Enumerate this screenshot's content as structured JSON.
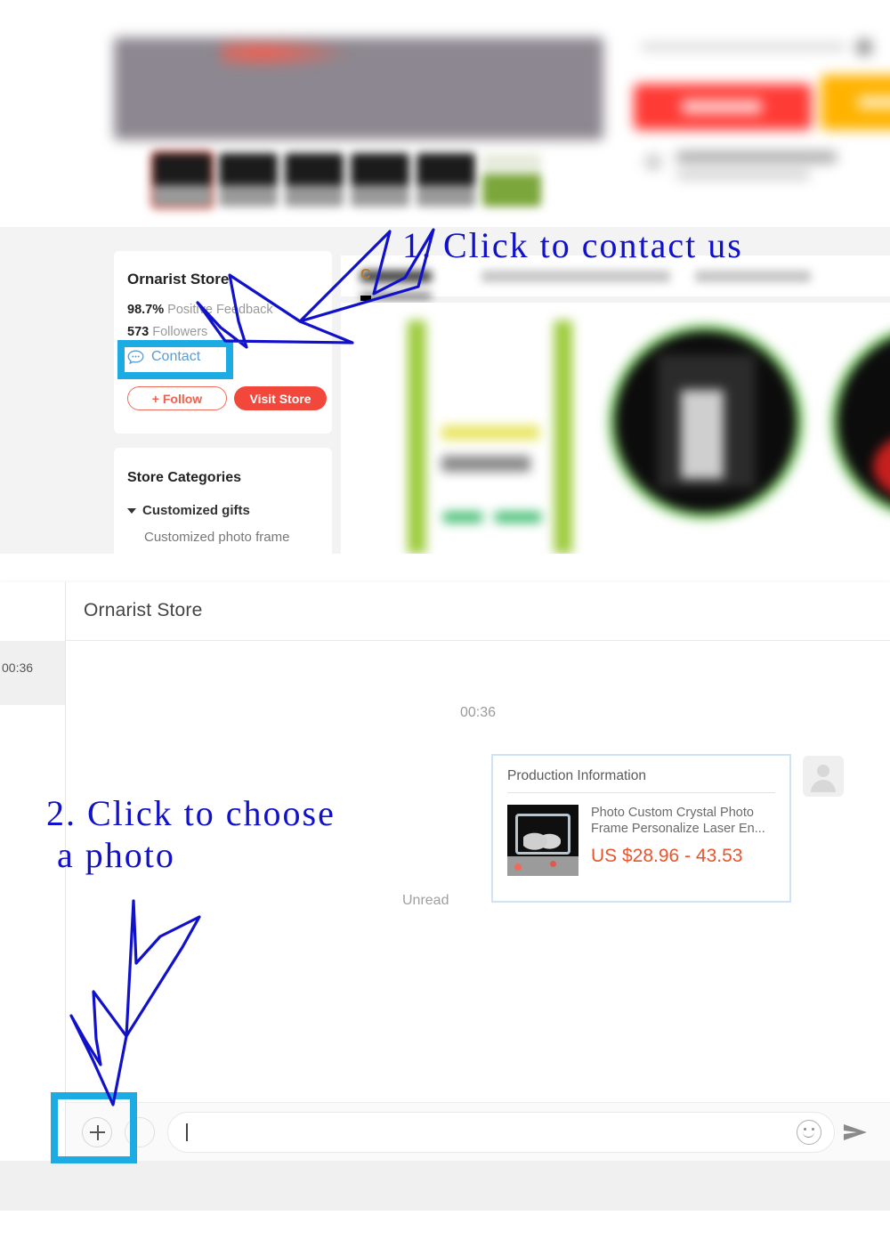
{
  "annotations": {
    "step1": "1. Click to contact us",
    "step2": "2. Click to choose\n a photo",
    "highlight_color": "#1cabe2",
    "arrow_color": "#1111cc"
  },
  "product_page": {
    "store_card": {
      "name": "Ornarist Store",
      "feedback_value": "98.7%",
      "feedback_label": "Positive Feedback",
      "followers_value": "573",
      "followers_label": "Followers",
      "contact_label": "Contact",
      "contact_icon": "chat-bubble-icon",
      "follow_button": "+ Follow",
      "visit_button": "Visit Store"
    },
    "categories_card": {
      "title": "Store Categories",
      "group": "Customized gifts",
      "item": "Customized photo frame"
    },
    "tabs": {
      "active": "C",
      "blurred_tab_count": 3
    },
    "gallery": {
      "thumbnail_count": 6,
      "selected_thumbnail_index": 0
    },
    "buy_block": {
      "buy_button_color": "#ff3b36",
      "cart_button_color": "#ffb300"
    }
  },
  "chat": {
    "header_title": "Ornarist Store",
    "sidebar": {
      "conversation_time": "00:36"
    },
    "day_stamp": "00:36",
    "unread_label": "Unread",
    "product_message": {
      "card_title": "Production Information",
      "product_name": "Photo Custom Crystal Photo Frame Personalize Laser En...",
      "price": "US $28.96 - 43.53",
      "price_color": "#e8552d",
      "avatar": "user-avatar-placeholder"
    },
    "input_bar": {
      "attach_icon": "plus-icon",
      "secondary_icon": "circle-icon",
      "message_value": "",
      "message_placeholder": "",
      "emoji_icon": "smiley-icon",
      "send_icon": "send-arrow-icon"
    }
  }
}
